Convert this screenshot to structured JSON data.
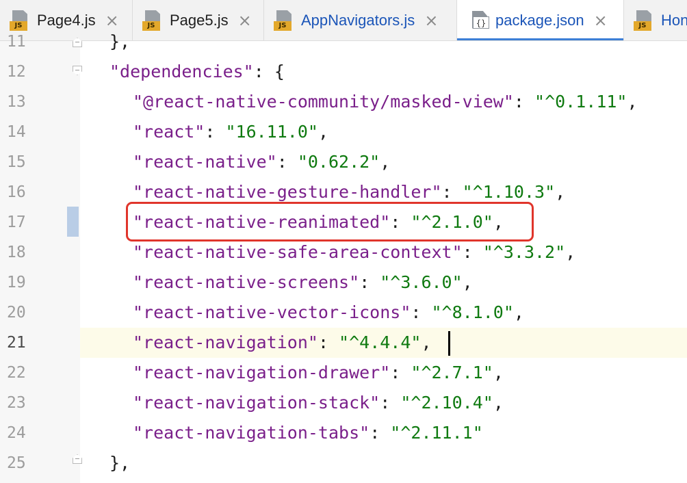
{
  "tabs": [
    {
      "label": "Page4.js",
      "icon": "js-file-icon",
      "active": false
    },
    {
      "label": "Page5.js",
      "icon": "js-file-icon",
      "active": false
    },
    {
      "label": "AppNavigators.js",
      "icon": "js-file-icon",
      "active": false
    },
    {
      "label": "package.json",
      "icon": "json-file-icon",
      "active": true
    },
    {
      "label": "Hon",
      "icon": "js-file-icon",
      "active": false
    }
  ],
  "tab_close_glyph": "×",
  "js_badge": "JS",
  "json_badge": "{}",
  "editor": {
    "current_line": 21,
    "highlighted_line": 17,
    "lines": [
      {
        "num": "11",
        "prefix": "",
        "key": "",
        "mid": "},",
        "value": "",
        "suffix": ""
      },
      {
        "num": "12",
        "prefix": "",
        "key": "\"dependencies\"",
        "mid": ": {",
        "value": "",
        "suffix": ""
      },
      {
        "num": "13",
        "prefix": "",
        "key": "\"@react-native-community/masked-view\"",
        "mid": ": ",
        "value": "\"^0.1.11\"",
        "suffix": ","
      },
      {
        "num": "14",
        "prefix": "",
        "key": "\"react\"",
        "mid": ": ",
        "value": "\"16.11.0\"",
        "suffix": ","
      },
      {
        "num": "15",
        "prefix": "",
        "key": "\"react-native\"",
        "mid": ": ",
        "value": "\"0.62.2\"",
        "suffix": ","
      },
      {
        "num": "16",
        "prefix": "",
        "key": "\"react-native-gesture-handler\"",
        "mid": ": ",
        "value": "\"^1.10.3\"",
        "suffix": ","
      },
      {
        "num": "17",
        "prefix": "",
        "key": "\"react-native-reanimated\"",
        "mid": ": ",
        "value": "\"^2.1.0\"",
        "suffix": ","
      },
      {
        "num": "18",
        "prefix": "",
        "key": "\"react-native-safe-area-context\"",
        "mid": ": ",
        "value": "\"^3.3.2\"",
        "suffix": ","
      },
      {
        "num": "19",
        "prefix": "",
        "key": "\"react-native-screens\"",
        "mid": ": ",
        "value": "\"^3.6.0\"",
        "suffix": ","
      },
      {
        "num": "20",
        "prefix": "",
        "key": "\"react-native-vector-icons\"",
        "mid": ": ",
        "value": "\"^8.1.0\"",
        "suffix": ","
      },
      {
        "num": "21",
        "prefix": "",
        "key": "\"react-navigation\"",
        "mid": ": ",
        "value": "\"^4.4.4\"",
        "suffix": ","
      },
      {
        "num": "22",
        "prefix": "",
        "key": "\"react-navigation-drawer\"",
        "mid": ": ",
        "value": "\"^2.7.1\"",
        "suffix": ","
      },
      {
        "num": "23",
        "prefix": "",
        "key": "\"react-navigation-stack\"",
        "mid": ": ",
        "value": "\"^2.10.4\"",
        "suffix": ","
      },
      {
        "num": "24",
        "prefix": "",
        "key": "\"react-navigation-tabs\"",
        "mid": ": ",
        "value": "\"^2.11.1\"",
        "suffix": ""
      },
      {
        "num": "25",
        "prefix": "",
        "key": "",
        "mid": "},",
        "value": "",
        "suffix": ""
      }
    ]
  },
  "colors": {
    "key": "#7a1f8a",
    "string": "#0f7a10",
    "highlight_box": "#e0352b",
    "active_tab_underline": "#3d7fd6",
    "current_line_bg": "#fdfbe9"
  }
}
